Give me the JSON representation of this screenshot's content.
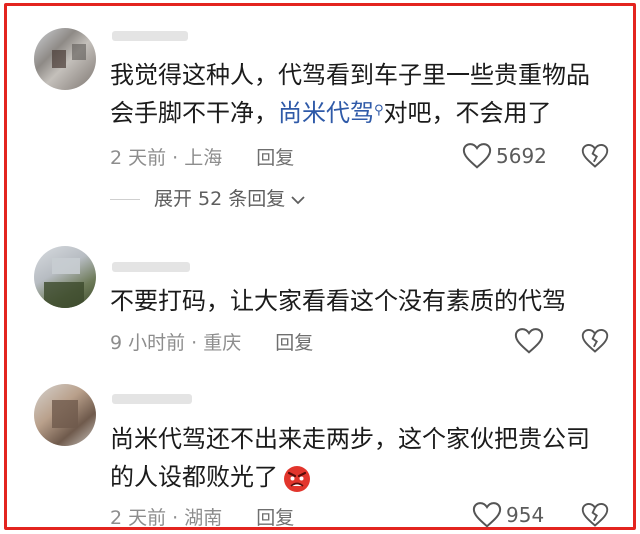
{
  "comments": [
    {
      "text_line1": "我觉得这种人，代驾看到车子里一些贵重物品",
      "text_pre": "会手脚不干净，",
      "link": "尚米代驾",
      "search_icon": "magnifier-icon",
      "text_post": "对吧，不会用了",
      "time": "2 天前",
      "location": "上海",
      "reply": "回复",
      "likes": "5692"
    },
    {
      "text_line1": "不要打码，让大家看看这个没有素质的代驾",
      "time": "9 小时前",
      "location": "重庆",
      "reply": "回复"
    },
    {
      "text_line1": "尚米代驾还不出来走两步，这个家伙把贵公司",
      "text_line2": "的人设都败光了",
      "emoji": "angry-face-emoji",
      "time": "2 天前",
      "location": "湖南",
      "reply": "回复",
      "likes": "954"
    }
  ],
  "expand_replies": "展开 52 条回复",
  "colors": {
    "frame": "#e3241f",
    "link": "#2f5aa8",
    "meta": "#8d8d8d"
  }
}
